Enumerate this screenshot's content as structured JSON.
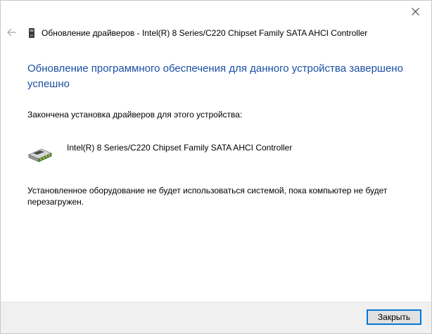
{
  "window": {
    "title": "Обновление драйверов - Intel(R) 8 Series/C220 Chipset Family SATA AHCI Controller"
  },
  "content": {
    "heading": "Обновление программного обеспечения для данного устройства завершено успешно",
    "install_label": "Закончена установка драйверов для этого устройства:",
    "device_name": "Intel(R) 8 Series/C220 Chipset Family SATA AHCI Controller",
    "restart_note": "Установленное оборудование не будет использоваться системой, пока компьютер не будет перезагружен."
  },
  "footer": {
    "close_label": "Закрыть"
  },
  "icons": {
    "close": "close-icon",
    "back": "back-arrow-icon",
    "device_small": "device-icon",
    "device_large": "storage-controller-icon"
  },
  "colors": {
    "heading": "#1b4fa3",
    "footer_bg": "#f0f0f0",
    "button_focus": "#0078d7"
  }
}
